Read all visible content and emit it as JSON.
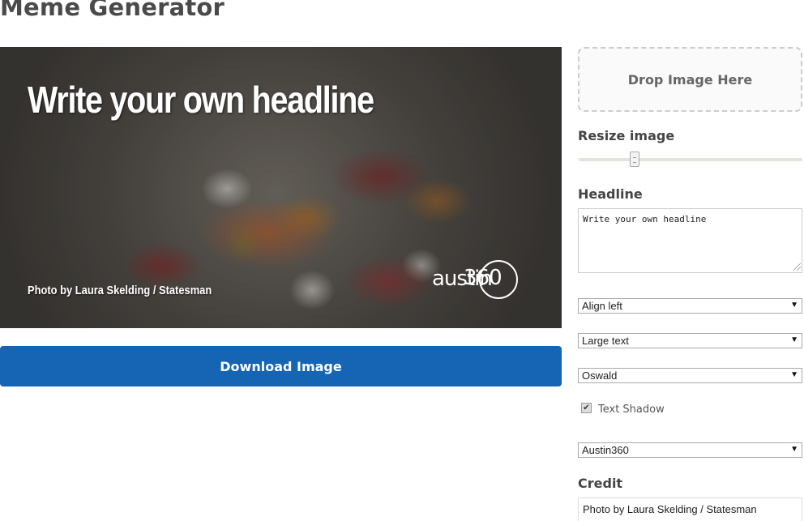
{
  "page": {
    "title": "Meme Generator"
  },
  "canvas": {
    "headline": "Write your own headline",
    "credit": "Photo by Laura Skelding / Statesman",
    "logo_word": "austin",
    "logo_number": "360"
  },
  "actions": {
    "download_label": "Download Image"
  },
  "controls": {
    "drop_label": "Drop Image Here",
    "resize_label": "Resize image",
    "resize_value": 0.25,
    "headline_label": "Headline",
    "headline_value": "Write your own headline",
    "align_value": "Align left",
    "size_value": "Large text",
    "font_value": "Oswald",
    "shadow_label": "Text Shadow",
    "shadow_checked": true,
    "logo_value": "Austin360",
    "credit_label": "Credit",
    "credit_value": "Photo by Laura Skelding / Statesman"
  },
  "icons": {
    "select_arrow": "chevron-down-icon",
    "checkbox": "check-icon"
  },
  "colors": {
    "button": "#1565b4",
    "title": "#4a4a4a"
  }
}
